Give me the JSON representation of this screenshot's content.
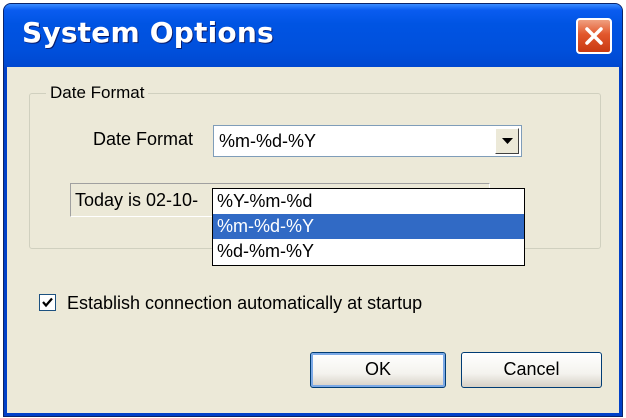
{
  "window": {
    "title": "System Options"
  },
  "date_format_group": {
    "legend": "Date Format",
    "field_label": "Date Format",
    "selected_value": "%m-%d-%Y",
    "status_text": "Today is 02-10-",
    "options": [
      "%Y-%m-%d",
      "%m-%d-%Y",
      "%d-%m-%Y"
    ],
    "highlighted_index": 1
  },
  "auto_connect": {
    "label": "Establish connection automatically at startup",
    "checked": true
  },
  "buttons": {
    "ok_label": "OK",
    "cancel_label": "Cancel"
  },
  "colors": {
    "titlebar": "#0054e3",
    "close_button": "#e2572c",
    "selection": "#316ac5",
    "dialog_background": "#ece9d8"
  }
}
